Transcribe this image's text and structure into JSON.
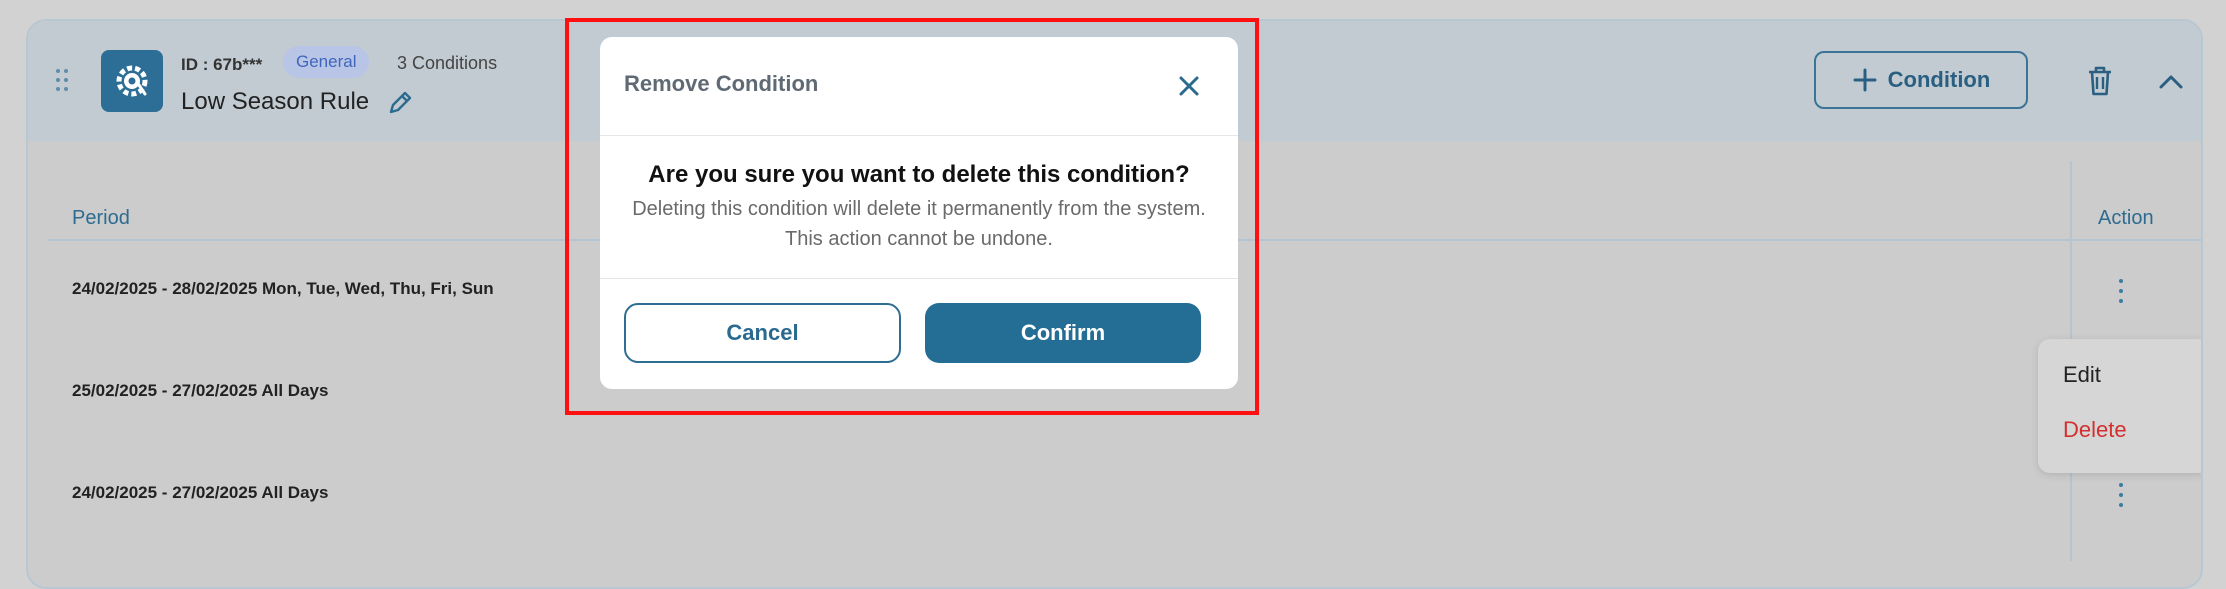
{
  "rule": {
    "id": "ID : 67b***",
    "tag": "General",
    "conditions_count": "3 Conditions",
    "name": "Low Season Rule",
    "add_label": "Condition"
  },
  "table": {
    "columns": [
      "Period",
      "Action"
    ],
    "rows": [
      {
        "period": "24/02/2025 - 28/02/2025 Mon, Tue, Wed, Thu, Fri, Sun"
      },
      {
        "period": "25/02/2025 - 27/02/2025 All Days"
      },
      {
        "period": "24/02/2025 - 27/02/2025 All Days"
      }
    ]
  },
  "action_menu": {
    "edit": "Edit",
    "delete": "Delete"
  },
  "modal": {
    "title": "Remove Condition",
    "question": "Are you sure you want to delete this condition?",
    "description": "Deleting this condition will delete it permanently from the system. This action cannot be undone.",
    "cancel_label": "Cancel",
    "confirm_label": "Confirm"
  },
  "colors": {
    "primary": "#246e96",
    "tag_text": "#3f66bd",
    "delete_text": "#d42f2f",
    "highlight": "#ff1010"
  }
}
